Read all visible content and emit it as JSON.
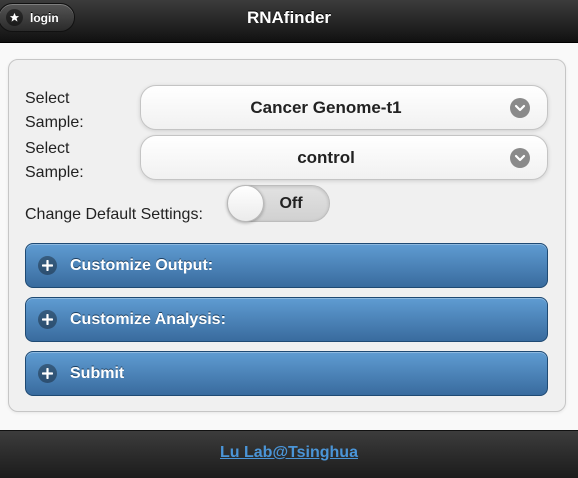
{
  "header": {
    "title": "RNAfinder",
    "login_label": "login",
    "login_icon": "star-icon"
  },
  "form": {
    "sample1": {
      "label": "Select Sample:",
      "value": "Cancer Genome-t1"
    },
    "sample2": {
      "label": "Select Sample:",
      "value": "control"
    },
    "settings_toggle": {
      "label": "Change Default Settings:",
      "state": "Off"
    },
    "sections": [
      {
        "label": "Customize Output:",
        "icon": "plus-icon"
      },
      {
        "label": "Customize Analysis:",
        "icon": "plus-icon"
      },
      {
        "label": "Submit",
        "icon": "plus-icon"
      }
    ]
  },
  "footer": {
    "link_label": "Lu Lab@Tsinghua"
  },
  "colors": {
    "header_bg": "#1a1a1a",
    "section_blue": "#4a82b8",
    "link_blue": "#4a95d8"
  }
}
